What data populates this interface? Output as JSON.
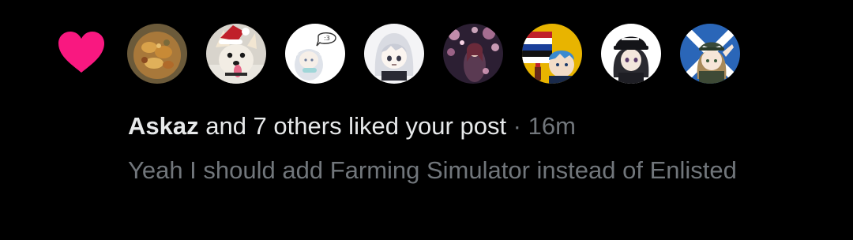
{
  "notification": {
    "actor": "Askaz",
    "action_text": " and 7 others liked your post",
    "separator": " · ",
    "time": "16m",
    "snippet": "Yeah I should add Farming Simulator instead of Enlisted"
  },
  "icons": {
    "like": "heart-icon"
  },
  "colors": {
    "background": "#000000",
    "heart": "#f91880",
    "primary_text": "#e7e9ea",
    "secondary_text": "#71767b"
  },
  "avatars": [
    {
      "name": "avatar-food-pile"
    },
    {
      "name": "avatar-dog-santa-hat"
    },
    {
      "name": "avatar-anime-girl-speech-bubble"
    },
    {
      "name": "avatar-anime-girl-white-hair"
    },
    {
      "name": "avatar-cherry-blossom-figure"
    },
    {
      "name": "avatar-flag-anime-character"
    },
    {
      "name": "avatar-anime-girl-black-cap"
    },
    {
      "name": "avatar-anime-girl-saluting"
    }
  ],
  "avatar_texts": {
    "speech_bubble": ":3"
  }
}
